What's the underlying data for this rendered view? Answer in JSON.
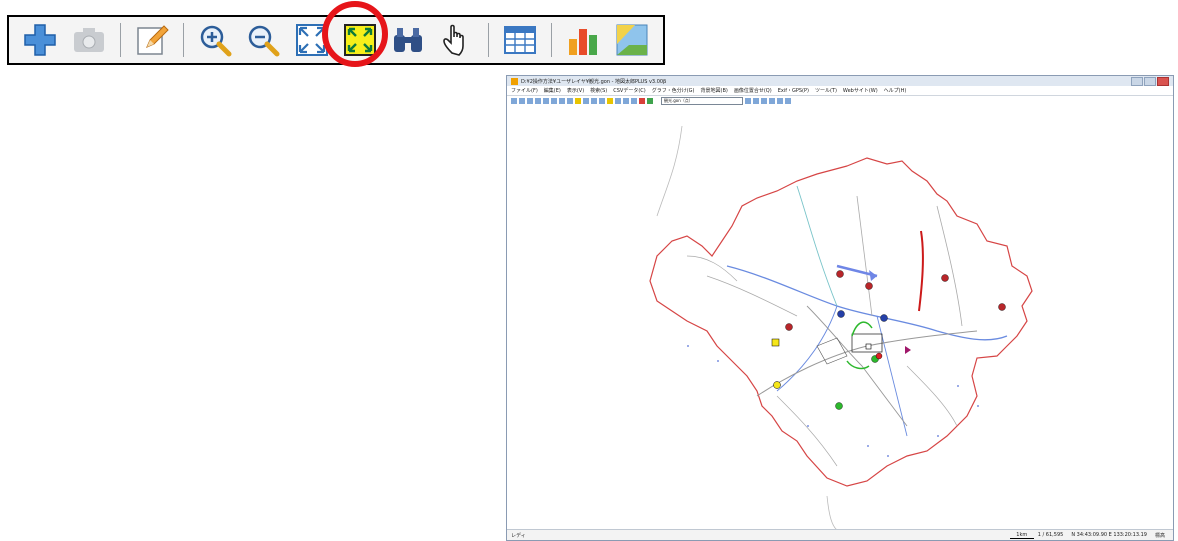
{
  "toolbar": {
    "buttons": [
      {
        "name": "plus-icon"
      },
      {
        "name": "camera-icon"
      },
      {
        "name": "pencil-icon"
      },
      {
        "name": "zoom-in-icon"
      },
      {
        "name": "zoom-out-icon"
      },
      {
        "name": "fit-all-icon"
      },
      {
        "name": "fit-layer-icon"
      },
      {
        "name": "binoculars-icon"
      },
      {
        "name": "hand-icon"
      },
      {
        "name": "table-icon"
      },
      {
        "name": "chart-icon"
      },
      {
        "name": "image-icon"
      }
    ],
    "highlighted": "fit-layer-icon",
    "highlight_color": "#e6151a"
  },
  "app": {
    "title": "D:¥2操作方法¥ユーザレイヤ¥観光.gon - 地図太郎PLUS v3.00β",
    "menu": [
      "ファイル(F)",
      "編集(E)",
      "表示(V)",
      "検索(S)",
      "CSVデータ(C)",
      "グラフ・色分け(G)",
      "背景地図(B)",
      "画像位置合せ(Q)",
      "Exif・GPS(P)",
      "ツール(T)",
      "Webサイト(W)",
      "ヘルプ(H)"
    ],
    "layer_combo": "観光.gon（点）",
    "status": {
      "left": "レディ",
      "scale_bar": "1km",
      "scale": "1 / 61,595",
      "coords": "N 34:43:09.90  E 133:20:13.19",
      "mode": "標高"
    }
  }
}
